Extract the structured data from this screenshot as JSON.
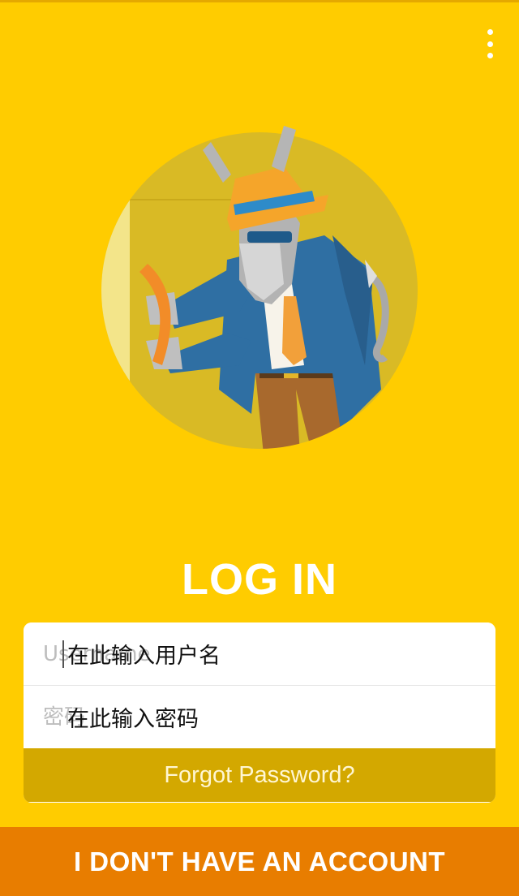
{
  "header": {
    "menu_icon": "more-vertical-icon"
  },
  "hero": {
    "image": "donkey-spy-mascot-illustration"
  },
  "title": "LOG IN",
  "form": {
    "username": {
      "placeholder": "Username",
      "hint": "在此输入用户名"
    },
    "password": {
      "placeholder": "密码",
      "hint": "在此输入密码"
    },
    "forgot_label": "Forgot Password?"
  },
  "footer": {
    "no_account_label": "I DON'T HAVE AN ACCOUNT"
  },
  "colors": {
    "background": "#FFCC00",
    "forgot_bar": "#D3A800",
    "bottom_button": "#E87D00",
    "jacket": "#2F6FA3",
    "hat": "#F5A52A"
  }
}
